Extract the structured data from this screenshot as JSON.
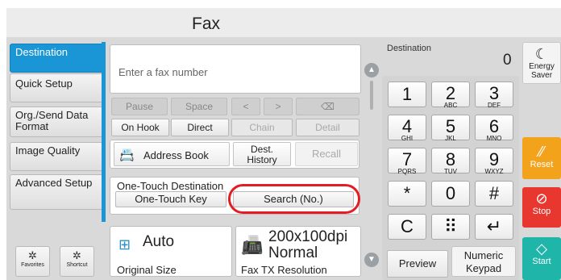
{
  "title": "Fax",
  "tabs": [
    "Destination",
    "Quick Setup",
    "Org./Send Data Format",
    "Image Quality",
    "Advanced Setup"
  ],
  "bottom_left": {
    "favorites": "Favorites",
    "shortcut": "Shortcut"
  },
  "fax_input": {
    "placeholder": "Enter a fax number"
  },
  "edit_row": {
    "pause": "Pause",
    "space": "Space",
    "left": "<",
    "right": ">",
    "backspace": "⌫"
  },
  "hook_row": {
    "on_hook": "On Hook",
    "direct": "Direct",
    "chain": "Chain",
    "detail": "Detail"
  },
  "addr_row": {
    "address_book": "Address Book",
    "dest_history_1": "Dest.",
    "dest_history_2": "History",
    "recall": "Recall"
  },
  "one_touch": {
    "label": "One-Touch Destination",
    "key": "One-Touch Key",
    "search": "Search (No.)"
  },
  "original_size": {
    "value": "Auto",
    "label": "Original Size"
  },
  "resolution": {
    "value1": "200x100dpi",
    "value2": "Normal",
    "label": "Fax TX Resolution"
  },
  "destination": {
    "label": "Destination",
    "count": "0"
  },
  "keypad": [
    {
      "d": "1",
      "s": ""
    },
    {
      "d": "2",
      "s": "ABC"
    },
    {
      "d": "3",
      "s": "DEF"
    },
    {
      "d": "4",
      "s": "GHI"
    },
    {
      "d": "5",
      "s": "JKL"
    },
    {
      "d": "6",
      "s": "MNO"
    },
    {
      "d": "7",
      "s": "PQRS"
    },
    {
      "d": "8",
      "s": "TUV"
    },
    {
      "d": "9",
      "s": "WXYZ"
    },
    {
      "d": "*",
      "s": ""
    },
    {
      "d": "0",
      "s": ""
    },
    {
      "d": "#",
      "s": ""
    },
    {
      "d": "C",
      "s": ""
    },
    {
      "d": "⠿",
      "s": ""
    },
    {
      "d": "↵",
      "s": ""
    }
  ],
  "keypad_bottom": {
    "preview": "Preview",
    "numeric_1": "Numeric",
    "numeric_2": "Keypad"
  },
  "rail": {
    "energy_1": "Energy",
    "energy_2": "Saver",
    "reset": "Reset",
    "stop": "Stop",
    "start": "Start"
  },
  "colors": {
    "accent": "#1a95d6",
    "reset": "#f2a31b",
    "stop": "#e8372f",
    "start": "#1fb5a9",
    "highlight_ring": "#e41d24"
  }
}
